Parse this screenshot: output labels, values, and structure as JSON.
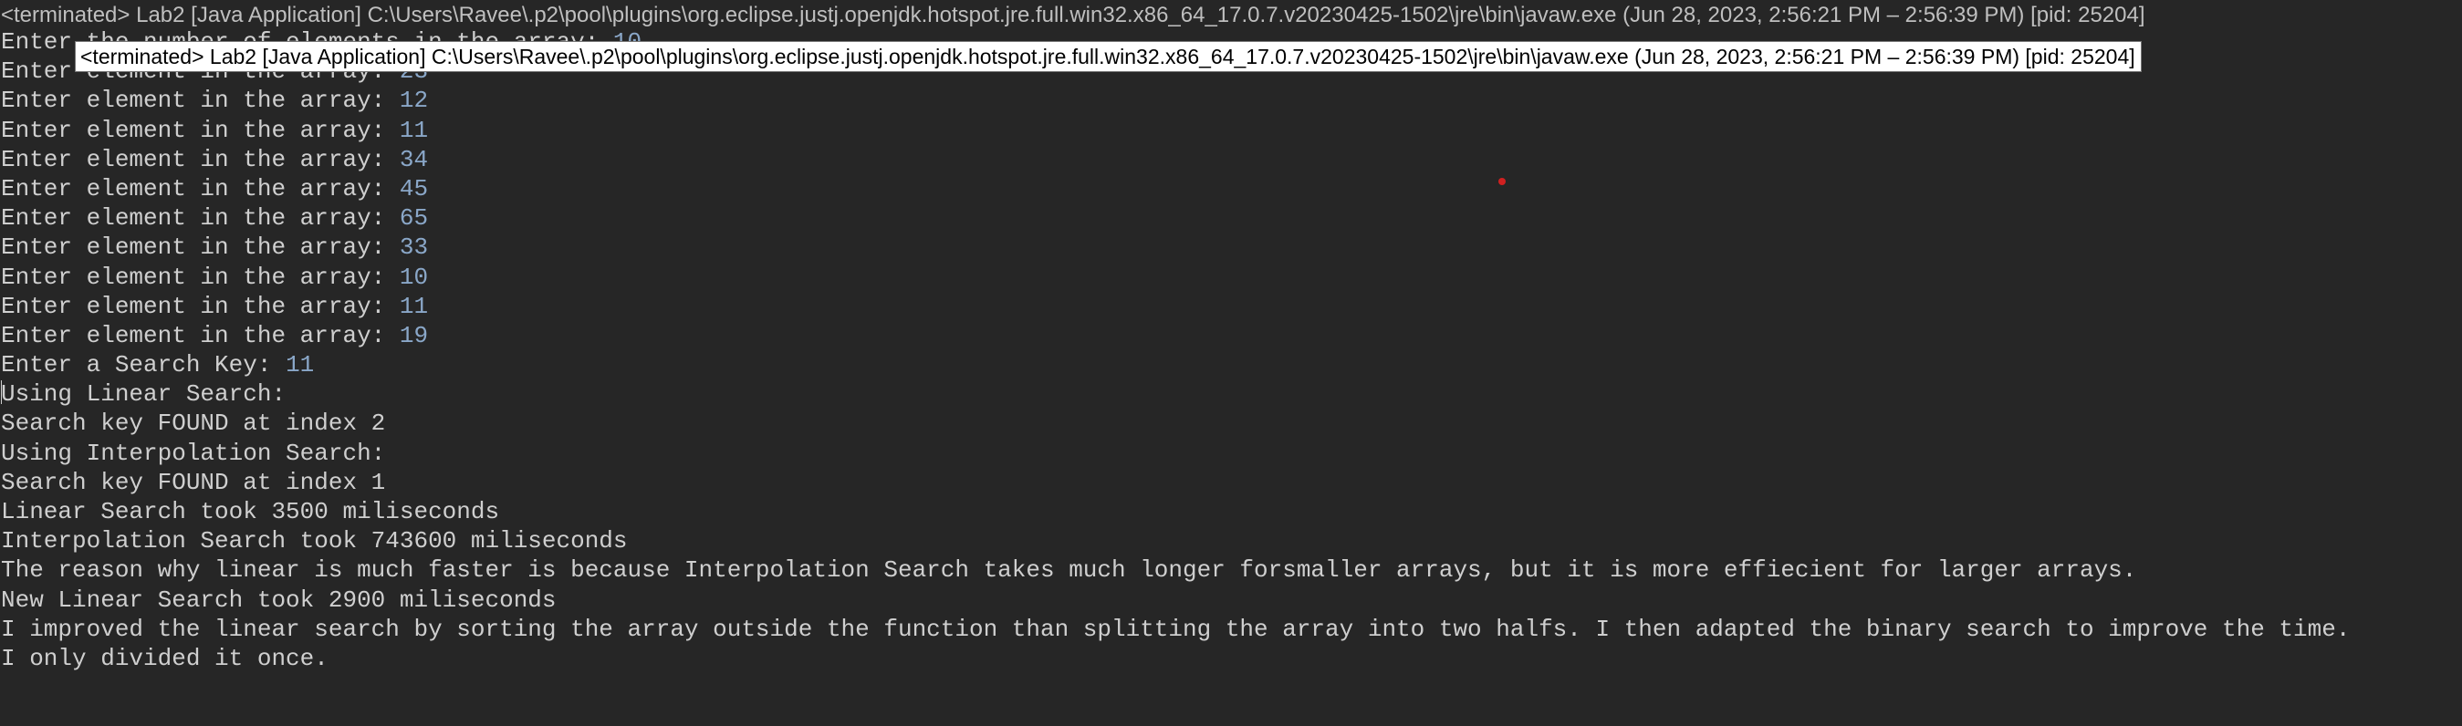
{
  "window": {
    "title": "<terminated> Lab2 [Java Application] C:\\Users\\Ravee\\.p2\\pool\\plugins\\org.eclipse.justj.openjdk.hotspot.jre.full.win32.x86_64_17.0.7.v20230425-1502\\jre\\bin\\javaw.exe  (Jun 28, 2023, 2:56:21 PM – 2:56:39 PM) [pid: 25204]"
  },
  "tooltip": {
    "text": "<terminated> Lab2 [Java Application] C:\\Users\\Ravee\\.p2\\pool\\plugins\\org.eclipse.justj.openjdk.hotspot.jre.full.win32.x86_64_17.0.7.v20230425-1502\\jre\\bin\\javaw.exe  (Jun 28, 2023, 2:56:21 PM – 2:56:39 PM) [pid: 25204]"
  },
  "console": {
    "lines": [
      {
        "prompt": "Enter the number of elements in the array: ",
        "input": "10"
      },
      {
        "prompt": "Enter element in the array: ",
        "input": "23"
      },
      {
        "prompt": "Enter element in the array: ",
        "input": "12"
      },
      {
        "prompt": "Enter element in the array: ",
        "input": "11"
      },
      {
        "prompt": "Enter element in the array: ",
        "input": "34"
      },
      {
        "prompt": "Enter element in the array: ",
        "input": "45"
      },
      {
        "prompt": "Enter element in the array: ",
        "input": "65"
      },
      {
        "prompt": "Enter element in the array: ",
        "input": "33"
      },
      {
        "prompt": "Enter element in the array: ",
        "input": "10"
      },
      {
        "prompt": "Enter element in the array: ",
        "input": "11"
      },
      {
        "prompt": "Enter element in the array: ",
        "input": "19"
      },
      {
        "prompt": "Enter a Search Key: ",
        "input": "11"
      },
      {
        "prompt": "Using Linear Search:",
        "input": ""
      },
      {
        "prompt": "Search key FOUND at index 2",
        "input": ""
      },
      {
        "prompt": "Using Interpolation Search:",
        "input": ""
      },
      {
        "prompt": "Search key FOUND at index 1",
        "input": ""
      },
      {
        "prompt": "Linear Search took 3500 miliseconds",
        "input": ""
      },
      {
        "prompt": "Interpolation Search took 743600 miliseconds",
        "input": ""
      },
      {
        "prompt": "The reason why linear is much faster is because Interpolation Search takes much longer forsmaller arrays, but it is more effiecient for larger arrays.",
        "input": ""
      },
      {
        "prompt": "New Linear Search took 2900 miliseconds",
        "input": ""
      },
      {
        "prompt": "I improved the linear search by sorting the array outside the function than splitting the array into two halfs. I then adapted the binary search to improve the time.",
        "input": ""
      },
      {
        "prompt": "I only divided it once.",
        "input": ""
      }
    ]
  },
  "colors": {
    "background": "#262626",
    "output_text": "#cfcfcf",
    "user_input_text": "#8aa7c8",
    "tooltip_background": "#ffffff",
    "mouse_cursor": "#d02020"
  }
}
